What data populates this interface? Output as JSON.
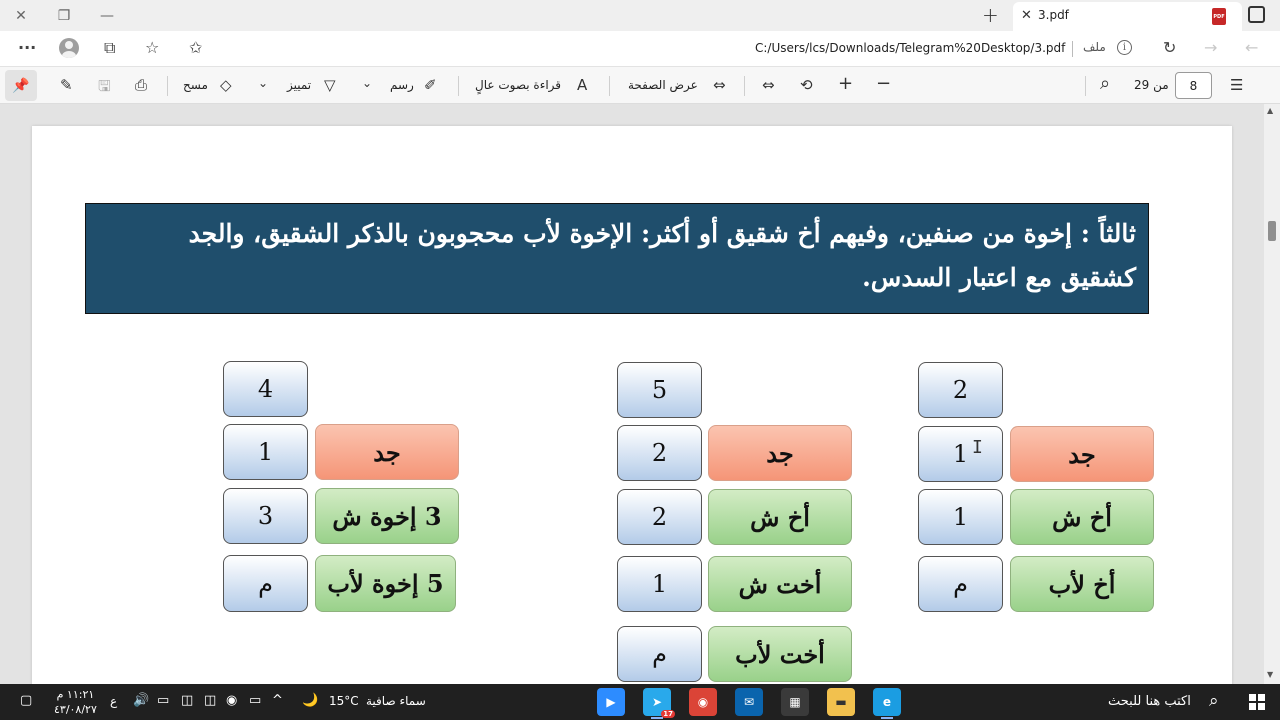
{
  "browser": {
    "tab_title": "3.pdf",
    "tab_pdf_badge": "PDF",
    "url": "C:/Users/lcs/Downloads/Telegram%20Desktop/3.pdf",
    "file_label": "ملف",
    "info_glyph": "i",
    "back_icon": "←",
    "forward_icon": "→",
    "refresh_icon": "↻",
    "menu_icon": "···",
    "collections_icon": "⧉",
    "favorites_icon": "☆",
    "add_fav_icon": "✩",
    "new_tab": "+",
    "win_close": "✕",
    "win_restore": "❐",
    "win_minimize": "—"
  },
  "toolbar": {
    "pin_icon": "📌",
    "page_current": "8",
    "page_of": "من 29",
    "zoom_out": "−",
    "zoom_in": "+",
    "rotate_icon": "⟲",
    "fit_icon": "⇔",
    "page_view": "عرض الصفحة",
    "read_aloud": "قراءة بصوت عالٍ",
    "read_aloud_icon": "A",
    "draw": "رسم",
    "highlight": "تمييز",
    "erase": "مسح",
    "dropdown_glyph": "⌄",
    "search_icon": "⌕",
    "toc_icon": "☰",
    "draw_icon": "✐",
    "highlight_icon": "▽",
    "erase_icon": "◇",
    "print_icon": "⎙",
    "save_icon": "🖫",
    "saveas_icon": "✎"
  },
  "document": {
    "banner_line1": "ثالثاً : إخوة من صنفين، وفيهم أخ شقيق أو أكثر: الإخوة لأب محجوبون بالذكر الشقيق، والجد",
    "banner_line2": "كشقيق مع اعتبار السدس.",
    "table_left": {
      "total": "4",
      "rows": [
        {
          "heir": "جد",
          "share": "1"
        },
        {
          "heir": "3  إخوة ش",
          "share": "3"
        },
        {
          "heir": "5  إخوة لأب",
          "share": "م"
        }
      ]
    },
    "table_middle": {
      "total": "5",
      "rows": [
        {
          "heir": "جد",
          "share": "2"
        },
        {
          "heir": "أخ ش",
          "share": "2"
        },
        {
          "heir": "أخت ش",
          "share": "1"
        },
        {
          "heir": "أخت لأب",
          "share": "م"
        }
      ]
    },
    "table_right": {
      "total": "2",
      "rows": [
        {
          "heir": "جد",
          "share": "1"
        },
        {
          "heir": "أخ ش",
          "share": "1"
        },
        {
          "heir": "أخ لأب",
          "share": "م"
        }
      ]
    },
    "cursor_glyph": "I"
  },
  "taskbar": {
    "search_placeholder": "اكتب هنا للبحث",
    "search_icon": "⌕",
    "weather": "سماء صافية",
    "temperature": "15°C",
    "moon_icon": "🌙",
    "time": "١١:٢١ م",
    "date": "٤٣/٠٨/٢٧",
    "lang": "ع",
    "telegram_badge": "17",
    "apps": {
      "zoom": "▶",
      "telegram": "➤",
      "chrome": "◉",
      "mail": "✉",
      "store": "▦",
      "explorer": "▬",
      "edge": "e"
    },
    "tray": {
      "up_arrow": "^",
      "volume": "🔊",
      "battery": "▭",
      "network": "◫",
      "record": "◉",
      "notification": "▢"
    }
  }
}
